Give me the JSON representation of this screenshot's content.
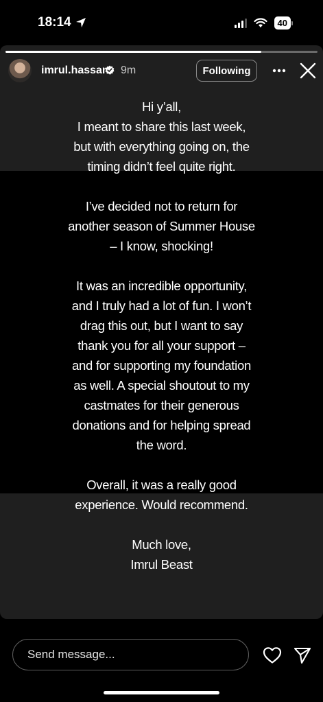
{
  "status_bar": {
    "time": "18:14",
    "battery": "40",
    "icons": [
      "location-arrow-icon",
      "cellular-signal-icon",
      "wifi-icon",
      "battery-icon"
    ]
  },
  "story": {
    "progress_fraction": 0.82,
    "user": {
      "username": "imrul.hassan",
      "verified": true,
      "time_ago": "9m"
    },
    "follow_label": "Following",
    "message": [
      [
        "Hi y’all,",
        "I meant to share this last week,",
        "but with everything going on, the",
        "timing didn’t feel quite right."
      ],
      [
        "I’ve decided not to return for",
        "another season of Summer House",
        "– I know, shocking!"
      ],
      [
        "It was an incredible opportunity,",
        "and I truly had a lot of fun. I won’t",
        "drag this out, but I want to say",
        "thank you for all your support –",
        "and for supporting my foundation",
        "as well. A special shoutout to my",
        "castmates for their generous",
        "donations and for helping spread",
        "the word."
      ],
      [
        "Overall, it was a really good",
        "experience. Would recommend."
      ],
      [
        "Much love,",
        "Imrul Beast"
      ]
    ]
  },
  "reply": {
    "placeholder": "Send message..."
  },
  "colors": {
    "background": "#000000",
    "story_background": "#1f1f1f",
    "input_border": "#5e5e5e",
    "progress_track": "#6a6a6a"
  }
}
